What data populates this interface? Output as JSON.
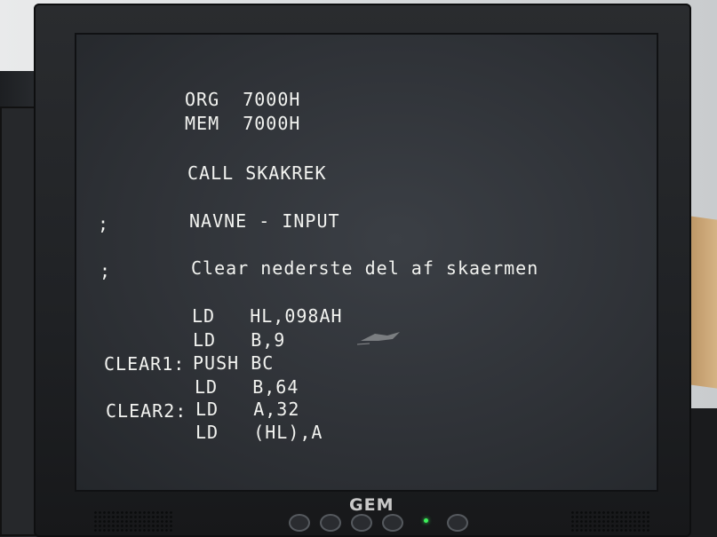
{
  "brand": "GEM",
  "code_lines": [
    {
      "label": "",
      "text": "ORG  7000H"
    },
    {
      "label": "",
      "text": "MEM  7000H"
    },
    {
      "label": "",
      "text": "CALL SKAKREK"
    },
    {
      "label": ";",
      "text": "NAVNE - INPUT"
    },
    {
      "label": ";",
      "text": "Clear nederste del af skaermen"
    },
    {
      "label": "",
      "text": "LD   HL,098AH"
    },
    {
      "label": "",
      "text": "LD   B,9"
    },
    {
      "label": "CLEAR1:",
      "text": "PUSH BC"
    },
    {
      "label": "",
      "text": "LD   B,64"
    },
    {
      "label": "CLEAR2:",
      "text": "LD   A,32"
    },
    {
      "label": "",
      "text": "LD   (HL),A"
    }
  ],
  "colors": {
    "screen_bg": "#2e3136",
    "text": "#f2f3f0",
    "power_led": "#3cf05a"
  }
}
